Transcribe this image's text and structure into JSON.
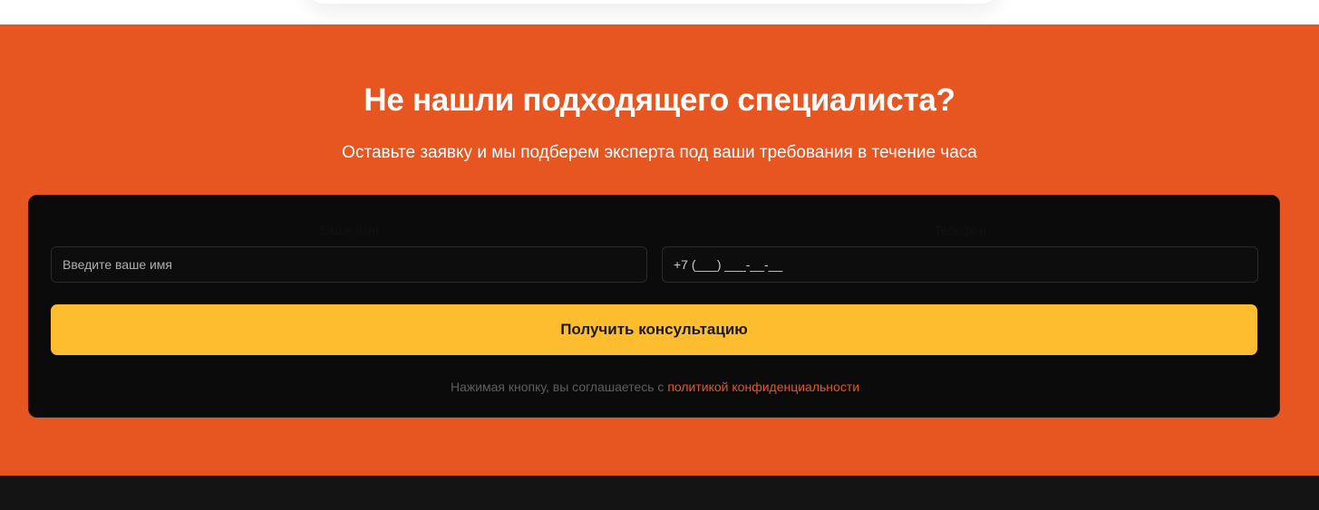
{
  "cta": {
    "title": "Не нашли подходящего специалиста?",
    "subtitle": "Оставьте заявку и мы подберем эксперта под ваши требования в течение часа"
  },
  "form": {
    "name_label": "Ваше имя",
    "name_placeholder": "Введите ваше имя",
    "phone_label": "Телефон",
    "phone_value": "+7 (___) ___-__-__",
    "submit_label": "Получить консультацию",
    "consent_text": "Нажимая кнопку, вы соглашаетесь с ",
    "consent_link": "политикой конфиденциальности"
  },
  "colors": {
    "section_bg": "#e75520",
    "card_bg": "#0b0b0b",
    "button_bg": "#fdbd2e",
    "link": "#e75520",
    "footer_bg": "#141414"
  }
}
